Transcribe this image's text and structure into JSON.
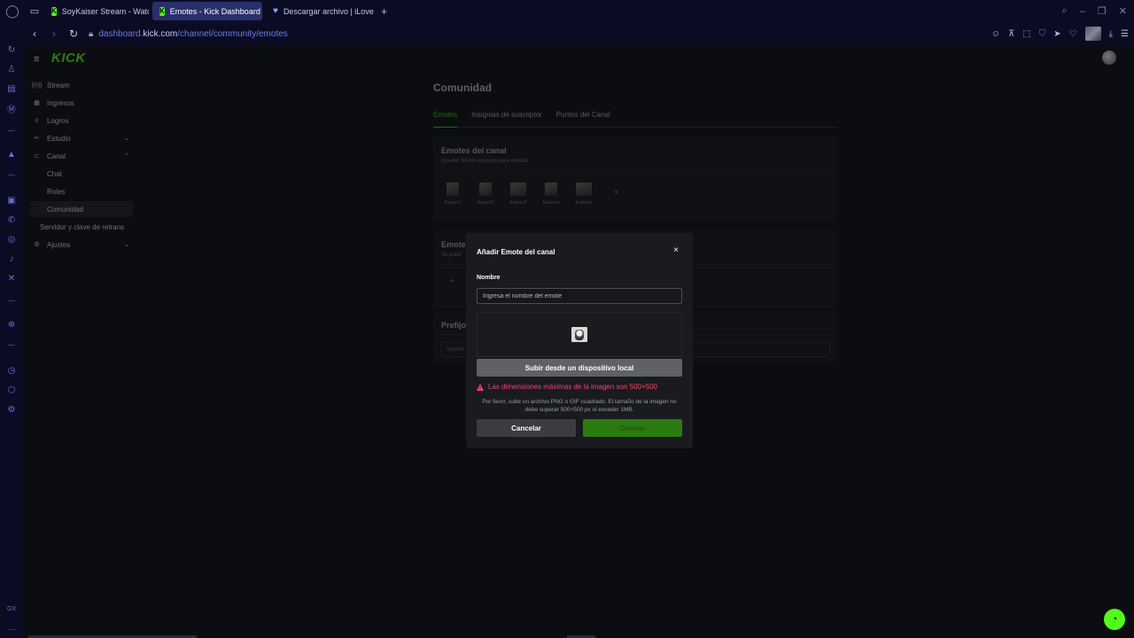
{
  "browser": {
    "tabs": [
      {
        "title": "SoyKaiser Stream - Watch",
        "favicon": "kick-icon"
      },
      {
        "title": "Emotes - Kick Dashboard",
        "favicon": "kick-icon"
      },
      {
        "title": "Descargar archivo | iLove",
        "favicon": "ilovepdf-icon"
      }
    ],
    "url_prefix": "dashboard.",
    "url_host": "kick.com",
    "url_path": "/channel/community/emotes",
    "sidebar_bottom_label": "GX"
  },
  "dashboard": {
    "logo": "KICK",
    "nav": [
      {
        "label": "Stream",
        "icon": "broadcast-icon"
      },
      {
        "label": "Ingresos",
        "icon": "money-icon"
      },
      {
        "label": "Logros",
        "icon": "trophy-icon"
      },
      {
        "label": "Estudio",
        "icon": "studio-icon"
      },
      {
        "label": "Canal",
        "icon": "channel-icon"
      },
      {
        "label": "Chat"
      },
      {
        "label": "Roles"
      },
      {
        "label": "Comunidad"
      },
      {
        "label": "Servidor y clave de retrans"
      },
      {
        "label": "Ajustes",
        "icon": "gear-icon"
      }
    ]
  },
  "main": {
    "title": "Comunidad",
    "tabs": [
      "Emotes",
      "Insignias de suscriptor",
      "Puntos del Canal"
    ],
    "channel_emotes": {
      "title": "Emotes del canal",
      "subtitle": "Quedan 55/60 espacios para emotes",
      "emotes": [
        "Kaiser1",
        "Kaiser2",
        "Kaiser3",
        "Kaiser4",
        "Kaiser5"
      ],
      "add_label": "+"
    },
    "second_section": {
      "title": "Emote",
      "subtitle": "Se pued",
      "add_label": "+"
    },
    "prefix_section": {
      "title": "Prefijo",
      "value": "soyshi"
    }
  },
  "modal": {
    "title": "Añadir Emote del canal",
    "close_label": "×",
    "name_label": "Nombre",
    "name_placeholder": "Ingresa el nombre del emote",
    "upload_label": "Subir desde un dispositivo local",
    "error_text": "Las dimensiones máximas de la imagen son 500×500",
    "help_text": "Por favor, sube un archivo PNG o GIF cuadrado. El tamaño de la imagen no debe superar 500×500 px ni exceder 1MB.",
    "cancel_label": "Cancelar",
    "save_label": "Guardar"
  },
  "colors": {
    "kick_green": "#53fc18",
    "error": "#f0466c",
    "save_button": "#2b7a10"
  }
}
